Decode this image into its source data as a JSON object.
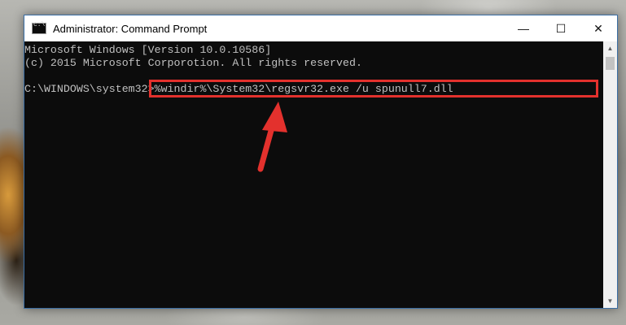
{
  "window": {
    "title": "Administrator: Command Prompt",
    "minimize_glyph": "—",
    "maximize_glyph": "☐",
    "close_glyph": "✕"
  },
  "console": {
    "lines": [
      "Microsoft Windows [Version 10.0.10586]",
      "(c) 2015 Microsoft Corporotion. All rights reserved."
    ],
    "prompt": "C:\\WINDOWS\\system32>",
    "command": "%windir%\\System32\\regsvr32.exe /u spunull7.dll"
  },
  "scrollbar": {
    "up_glyph": "▲",
    "down_glyph": "▼"
  },
  "colors": {
    "console_bg": "#0c0c0c",
    "console_text": "#c0c0c0",
    "highlight": "#e3312d"
  },
  "icons": [
    "cmd-app-icon",
    "minimize-icon",
    "maximize-icon",
    "close-icon",
    "red-arrow-annotation"
  ]
}
